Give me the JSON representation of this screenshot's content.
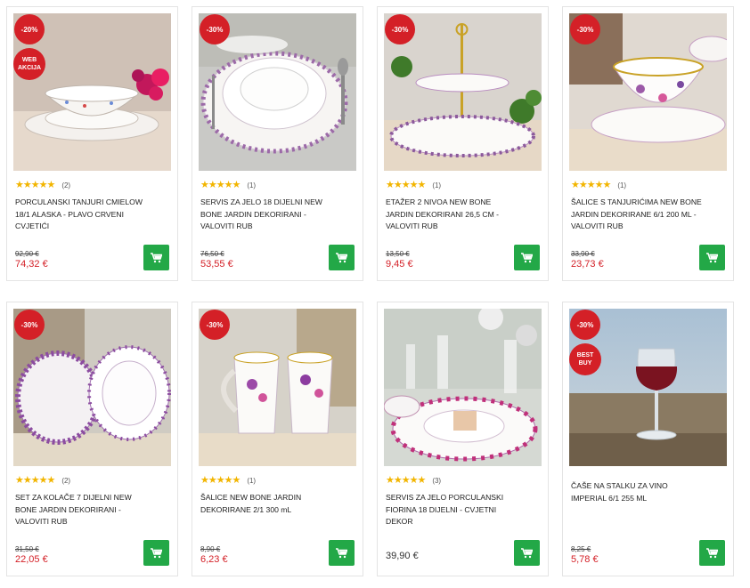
{
  "products": [
    {
      "discount": "-20%",
      "extra_badge": "WEB AKCIJA",
      "rating_count": "(2)",
      "title": "PORCULANSKI TANJURI CMIELOW 18/1 ALASKA - PLAVO CRVENI CVJETIĆI",
      "old_price": "92,90 €",
      "price": "74,32 €"
    },
    {
      "discount": "-30%",
      "extra_badge": "",
      "rating_count": "(1)",
      "title": "SERVIS ZA JELO 18 DIJELNI NEW BONE JARDIN DEKORIRANI - VALOVITI RUB",
      "old_price": "76,50 €",
      "price": "53,55 €"
    },
    {
      "discount": "-30%",
      "extra_badge": "",
      "rating_count": "(1)",
      "title": "ETAŽER 2 NIVOA NEW BONE JARDIN DEKORIRANI 26,5 CM - VALOVITI RUB",
      "old_price": "13,50 €",
      "price": "9,45 €"
    },
    {
      "discount": "-30%",
      "extra_badge": "",
      "rating_count": "(1)",
      "title": "ŠALICE S TANJURIĆIMA NEW BONE JARDIN DEKORIRANE 6/1 200 ML - VALOVITI RUB",
      "old_price": "33,90 €",
      "price": "23,73 €"
    },
    {
      "discount": "-30%",
      "extra_badge": "",
      "rating_count": "(2)",
      "title": "SET ZA KOLAČE 7 DIJELNI NEW BONE JARDIN DEKORIRANI - VALOVITI RUB",
      "old_price": "31,50 €",
      "price": "22,05 €"
    },
    {
      "discount": "-30%",
      "extra_badge": "",
      "rating_count": "(1)",
      "title": "ŠALICE NEW BONE JARDIN DEKORIRANE 2/1 300 mL",
      "old_price": "8,90 €",
      "price": "6,23 €"
    },
    {
      "discount": "",
      "extra_badge": "",
      "rating_count": "(3)",
      "title": "SERVIS ZA JELO PORCULANSKI FIORINA 18 DIJELNI - CVJETNI DEKOR",
      "old_price": "",
      "price": "39,90 €"
    },
    {
      "discount": "-30%",
      "extra_badge": "BEST BUY",
      "rating_count": "",
      "title": "ČAŠE NA STALKU ZA VINO IMPERIAL 6/1 255 ML",
      "old_price": "8,25 €",
      "price": "5,78 €"
    }
  ],
  "stars": "★★★★★",
  "icons": {
    "cart": "cart-icon",
    "star": "star-icon"
  },
  "colors": {
    "sale_red": "#d42027",
    "cart_green": "#23a847",
    "star_gold": "#f2b500"
  }
}
